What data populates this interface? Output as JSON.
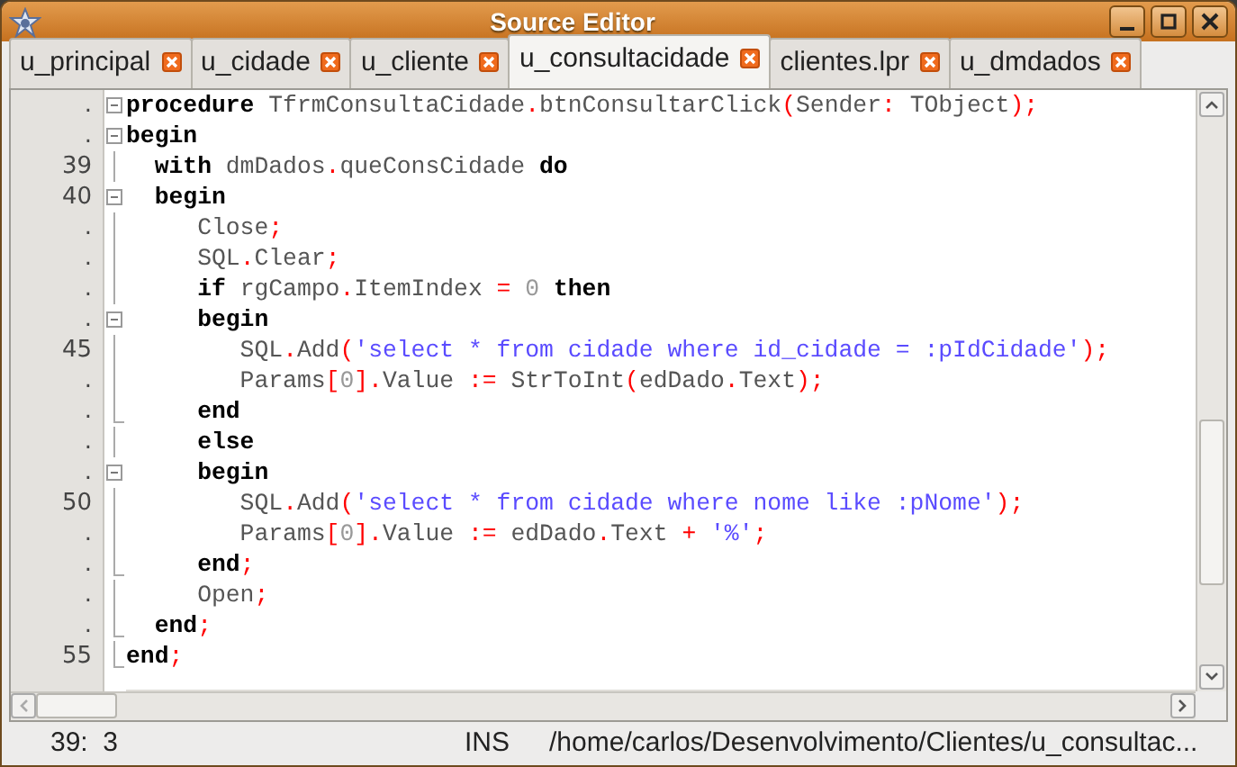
{
  "window": {
    "title": "Source Editor"
  },
  "tabs": [
    {
      "label": "u_principal",
      "selected": false
    },
    {
      "label": "u_cidade",
      "selected": false
    },
    {
      "label": "u_cliente",
      "selected": false
    },
    {
      "label": "u_consultacidade",
      "selected": true
    },
    {
      "label": "clientes.lpr",
      "selected": false
    },
    {
      "label": "u_dmdados",
      "selected": false
    }
  ],
  "editor": {
    "lines": [
      {
        "number": ".",
        "kind": "open",
        "tokens": [
          {
            "kind": "kw",
            "text": "procedure"
          },
          {
            "kind": "id",
            "text": " TfrmConsultaCidade"
          },
          {
            "kind": "sym",
            "text": "."
          },
          {
            "kind": "id",
            "text": "btnConsultarClick"
          },
          {
            "kind": "sym",
            "text": "("
          },
          {
            "kind": "id",
            "text": "Sender"
          },
          {
            "kind": "sym",
            "text": ":"
          },
          {
            "kind": "id",
            "text": " TObject"
          },
          {
            "kind": "sym",
            "text": ");"
          }
        ]
      },
      {
        "number": ".",
        "kind": "open",
        "tokens": [
          {
            "kind": "kw",
            "text": "begin"
          }
        ]
      },
      {
        "number": "39",
        "kind": "line",
        "tokens": [
          {
            "kind": "kw",
            "text": "  with"
          },
          {
            "kind": "id",
            "text": " dmDados"
          },
          {
            "kind": "sym",
            "text": "."
          },
          {
            "kind": "id",
            "text": "queConsCidade "
          },
          {
            "kind": "kw",
            "text": "do"
          }
        ]
      },
      {
        "number": "40",
        "kind": "open",
        "tokens": [
          {
            "kind": "kw",
            "text": "  begin"
          }
        ]
      },
      {
        "number": ".",
        "kind": "line",
        "tokens": [
          {
            "kind": "id",
            "text": "     Close"
          },
          {
            "kind": "sym",
            "text": ";"
          }
        ]
      },
      {
        "number": ".",
        "kind": "line",
        "tokens": [
          {
            "kind": "id",
            "text": "     SQL"
          },
          {
            "kind": "sym",
            "text": "."
          },
          {
            "kind": "id",
            "text": "Clear"
          },
          {
            "kind": "sym",
            "text": ";"
          }
        ]
      },
      {
        "number": ".",
        "kind": "line",
        "tokens": [
          {
            "kind": "kw",
            "text": "     if"
          },
          {
            "kind": "id",
            "text": " rgCampo"
          },
          {
            "kind": "sym",
            "text": "."
          },
          {
            "kind": "id",
            "text": "ItemIndex "
          },
          {
            "kind": "sym",
            "text": "="
          },
          {
            "kind": "num",
            "text": " 0 "
          },
          {
            "kind": "kw",
            "text": "then"
          }
        ]
      },
      {
        "number": ".",
        "kind": "open",
        "tokens": [
          {
            "kind": "kw",
            "text": "     begin"
          }
        ]
      },
      {
        "number": "45",
        "kind": "line",
        "tokens": [
          {
            "kind": "id",
            "text": "        SQL"
          },
          {
            "kind": "sym",
            "text": "."
          },
          {
            "kind": "id",
            "text": "Add"
          },
          {
            "kind": "sym",
            "text": "("
          },
          {
            "kind": "str",
            "text": "'select * from cidade where id_cidade = :pIdCidade'"
          },
          {
            "kind": "sym",
            "text": ");"
          }
        ]
      },
      {
        "number": ".",
        "kind": "line",
        "tokens": [
          {
            "kind": "id",
            "text": "        Params"
          },
          {
            "kind": "sym",
            "text": "["
          },
          {
            "kind": "num",
            "text": "0"
          },
          {
            "kind": "sym",
            "text": "]."
          },
          {
            "kind": "id",
            "text": "Value "
          },
          {
            "kind": "sym",
            "text": ":="
          },
          {
            "kind": "id",
            "text": " StrToInt"
          },
          {
            "kind": "sym",
            "text": "("
          },
          {
            "kind": "id",
            "text": "edDado"
          },
          {
            "kind": "sym",
            "text": "."
          },
          {
            "kind": "id",
            "text": "Text"
          },
          {
            "kind": "sym",
            "text": ");"
          }
        ]
      },
      {
        "number": ".",
        "kind": "end",
        "tokens": [
          {
            "kind": "kw",
            "text": "     end"
          }
        ]
      },
      {
        "number": ".",
        "kind": "line",
        "tokens": [
          {
            "kind": "kw",
            "text": "     else"
          }
        ]
      },
      {
        "number": ".",
        "kind": "open",
        "tokens": [
          {
            "kind": "kw",
            "text": "     begin"
          }
        ]
      },
      {
        "number": "50",
        "kind": "line",
        "tokens": [
          {
            "kind": "id",
            "text": "        SQL"
          },
          {
            "kind": "sym",
            "text": "."
          },
          {
            "kind": "id",
            "text": "Add"
          },
          {
            "kind": "sym",
            "text": "("
          },
          {
            "kind": "str",
            "text": "'select * from cidade where nome like :pNome'"
          },
          {
            "kind": "sym",
            "text": ");"
          }
        ]
      },
      {
        "number": ".",
        "kind": "line",
        "tokens": [
          {
            "kind": "id",
            "text": "        Params"
          },
          {
            "kind": "sym",
            "text": "["
          },
          {
            "kind": "num",
            "text": "0"
          },
          {
            "kind": "sym",
            "text": "]."
          },
          {
            "kind": "id",
            "text": "Value "
          },
          {
            "kind": "sym",
            "text": ":="
          },
          {
            "kind": "id",
            "text": " edDado"
          },
          {
            "kind": "sym",
            "text": "."
          },
          {
            "kind": "id",
            "text": "Text "
          },
          {
            "kind": "sym",
            "text": "+"
          },
          {
            "kind": "str",
            "text": " '%'"
          },
          {
            "kind": "sym",
            "text": ";"
          }
        ]
      },
      {
        "number": ".",
        "kind": "end",
        "tokens": [
          {
            "kind": "kw",
            "text": "     end"
          },
          {
            "kind": "sym",
            "text": ";"
          }
        ]
      },
      {
        "number": ".",
        "kind": "line",
        "tokens": [
          {
            "kind": "id",
            "text": "     Open"
          },
          {
            "kind": "sym",
            "text": ";"
          }
        ]
      },
      {
        "number": ".",
        "kind": "end",
        "tokens": [
          {
            "kind": "kw",
            "text": "  end"
          },
          {
            "kind": "sym",
            "text": ";"
          }
        ]
      },
      {
        "number": "55",
        "kind": "end",
        "tokens": [
          {
            "kind": "kw",
            "text": "end"
          },
          {
            "kind": "sym",
            "text": ";"
          }
        ]
      }
    ]
  },
  "status_bar": {
    "position": "39:  3",
    "mode": "INS",
    "path": "/home/carlos/Desenvolvimento/Clientes/u_consultac..."
  }
}
